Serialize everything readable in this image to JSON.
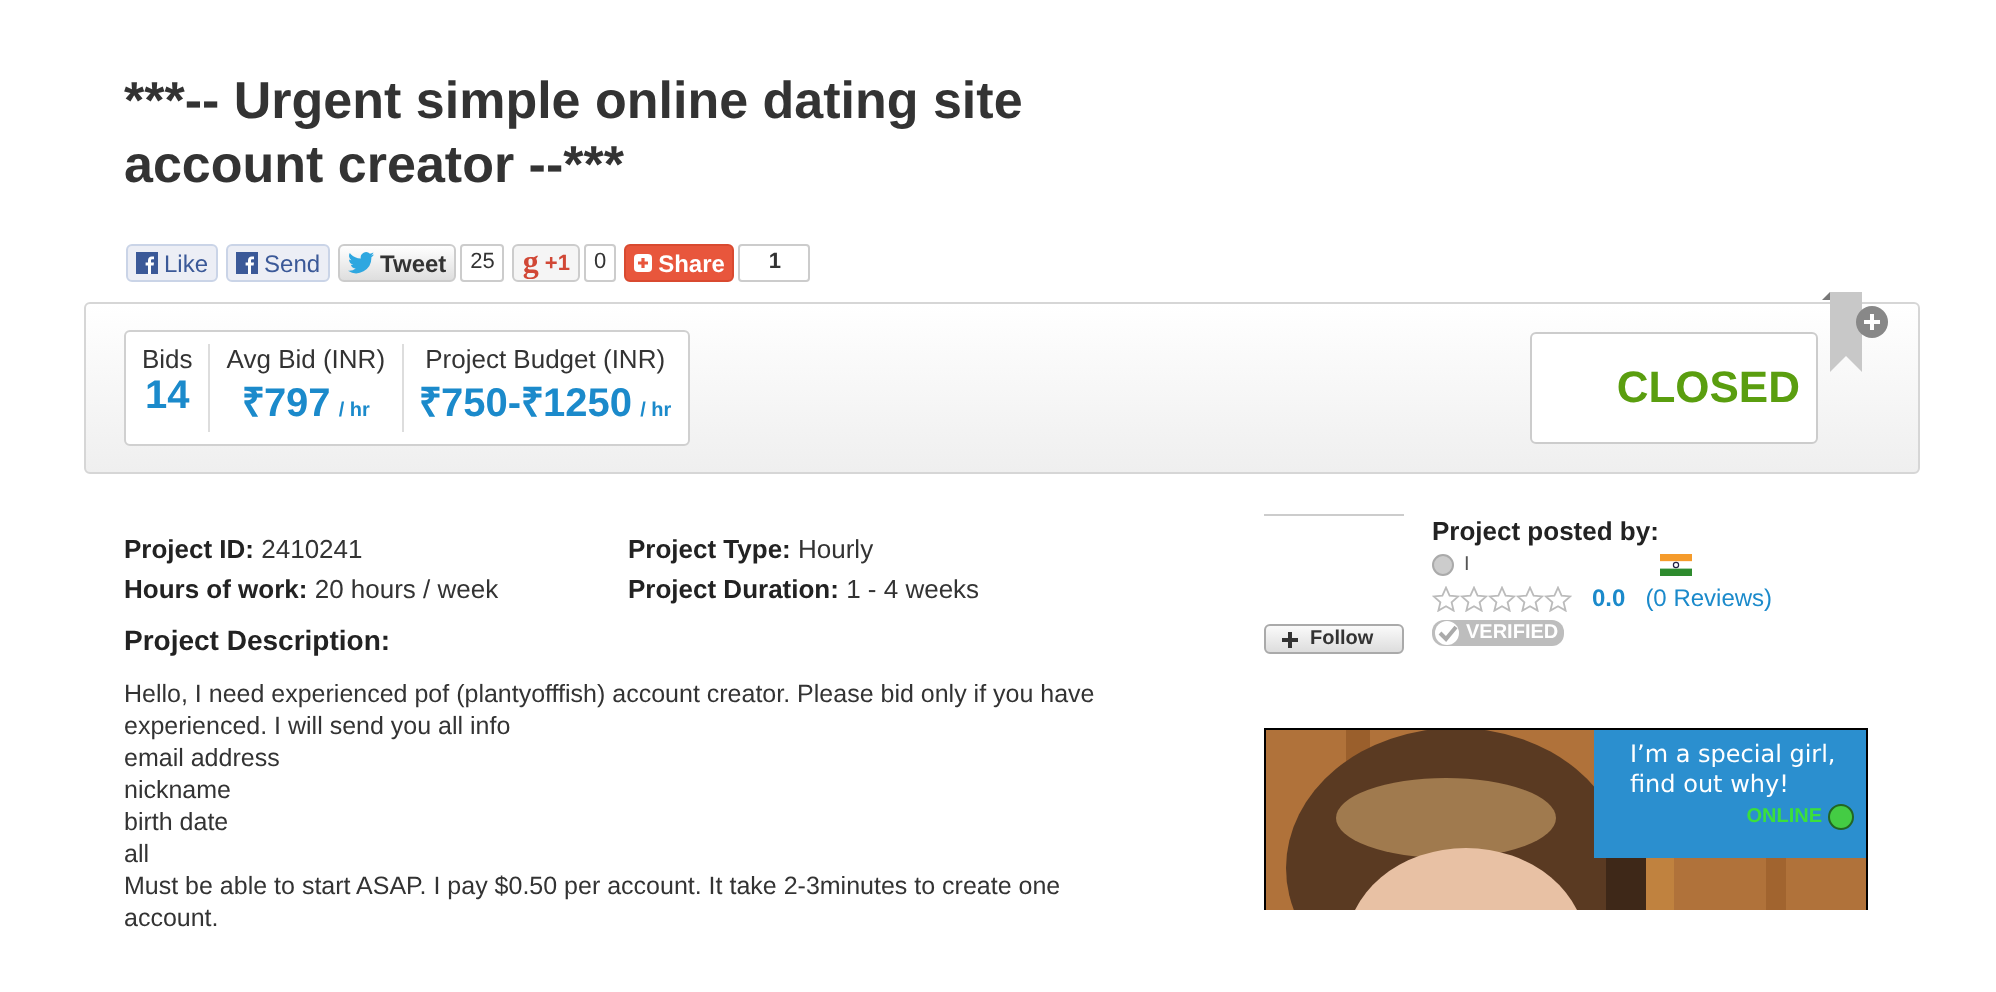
{
  "title": "***-- Urgent simple online dating site account creator --***",
  "social": [
    {
      "kind": "facebook",
      "label": "Like"
    },
    {
      "kind": "facebook",
      "label": "Send"
    },
    {
      "kind": "twitter",
      "label": "Tweet",
      "count": "25"
    },
    {
      "kind": "gplus",
      "icon_text": "g",
      "label": "+1",
      "count": "0"
    },
    {
      "kind": "share",
      "label": "Share",
      "count": "1"
    }
  ],
  "stats": [
    {
      "label": "Bids",
      "value": "14"
    },
    {
      "label": "Avg Bid (INR)",
      "value": "₹797",
      "unit": "/ hr"
    },
    {
      "label": "Project Budget (INR)",
      "value": "₹750-₹1250",
      "unit": "/ hr"
    }
  ],
  "status": "CLOSED",
  "details": [
    {
      "label": "Project ID:",
      "value": "2410241"
    },
    {
      "label": "Project Type:",
      "value": "Hourly"
    },
    {
      "label": "Hours of work:",
      "value": "20 hours / week"
    },
    {
      "label": "Project Duration:",
      "value": "1 - 4 weeks"
    }
  ],
  "description_heading": "Project Description:",
  "description_lines": [
    "Hello, I need experienced pof (plantyofffish) account creator. Please bid only if you have experienced. I will send you all info",
    "email address",
    "nickname",
    "birth date",
    "all",
    "Must be able to start ASAP. I pay $0.50 per account. It take 2-3minutes to create one account."
  ],
  "follow_button": "Follow",
  "poster": {
    "heading": "Project posted by:",
    "username": "I",
    "online": false,
    "stars": 0,
    "rating": "0.0",
    "reviews": "(0 Reviews)",
    "verified_label": "VERIFIED"
  },
  "ad": {
    "caption": "I’m a special girl, find out why!",
    "badge": "ONLINE"
  }
}
